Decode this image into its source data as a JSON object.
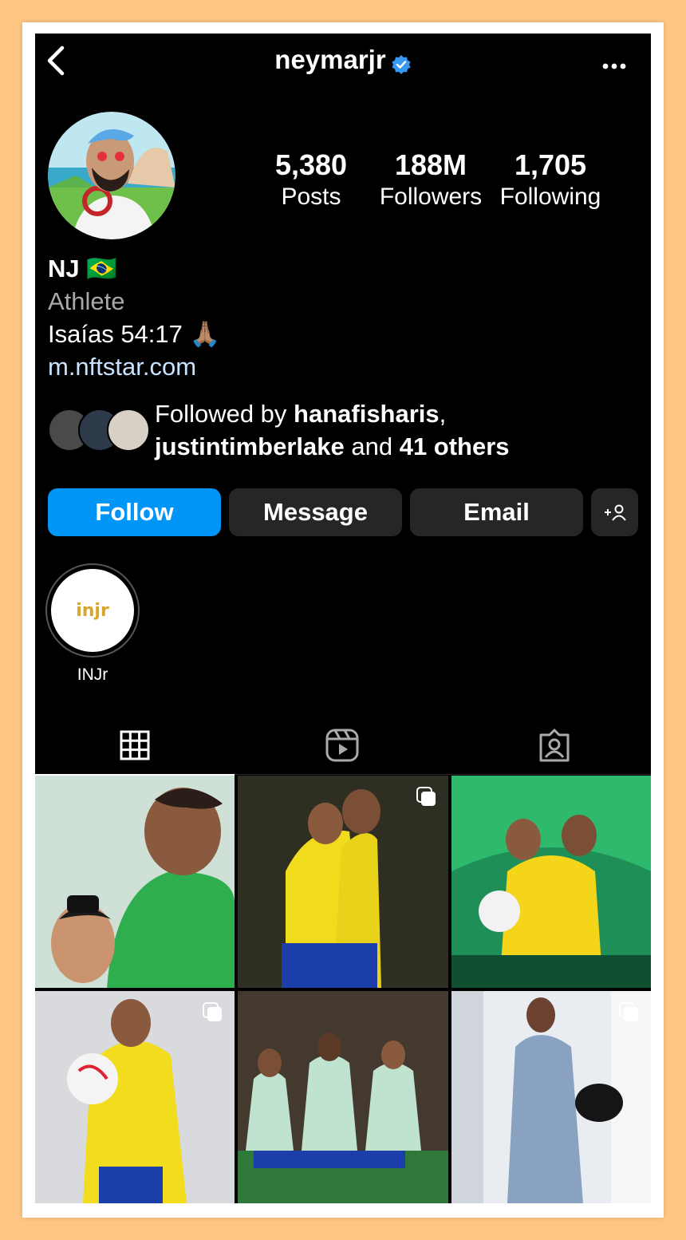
{
  "profile": {
    "username": "neymarjr",
    "name": "NJ",
    "flag": "🇧🇷",
    "category": "Athlete",
    "bio_line": "Isaías 54:17 🙏🏽",
    "link": "m.nftstar.com"
  },
  "stats": [
    {
      "value": "5,380",
      "label": "Posts"
    },
    {
      "value": "188M",
      "label": "Followers"
    },
    {
      "value": "1,705",
      "label": "Following"
    }
  ],
  "followed_by": {
    "prefix": "Followed by ",
    "user1": "hanafisharis",
    "sep": ",",
    "user2": "justintimberlake",
    "and": " and ",
    "others": "41 others"
  },
  "buttons": {
    "follow": "Follow",
    "message": "Message",
    "email": "Email"
  },
  "highlights": [
    {
      "label": "INJr",
      "logo_text": "injr"
    }
  ],
  "icons": {
    "back": "chevron-left-icon",
    "verified": "verified-badge-icon",
    "more": "more-horizontal-icon",
    "add_person": "add-person-icon",
    "grid": "grid-icon",
    "reels": "reels-icon",
    "tagged": "tagged-icon",
    "multiple": "multiple-photos-icon"
  },
  "colors": {
    "background": "#000000",
    "accent": "#0095f6",
    "secondary_button": "#262626",
    "verified": "#3897f0",
    "frame": "#fdc682"
  },
  "posts": [
    {
      "multiple": false
    },
    {
      "multiple": true
    },
    {
      "multiple": false
    },
    {
      "multiple": true
    },
    {
      "multiple": false
    },
    {
      "multiple": true
    }
  ]
}
